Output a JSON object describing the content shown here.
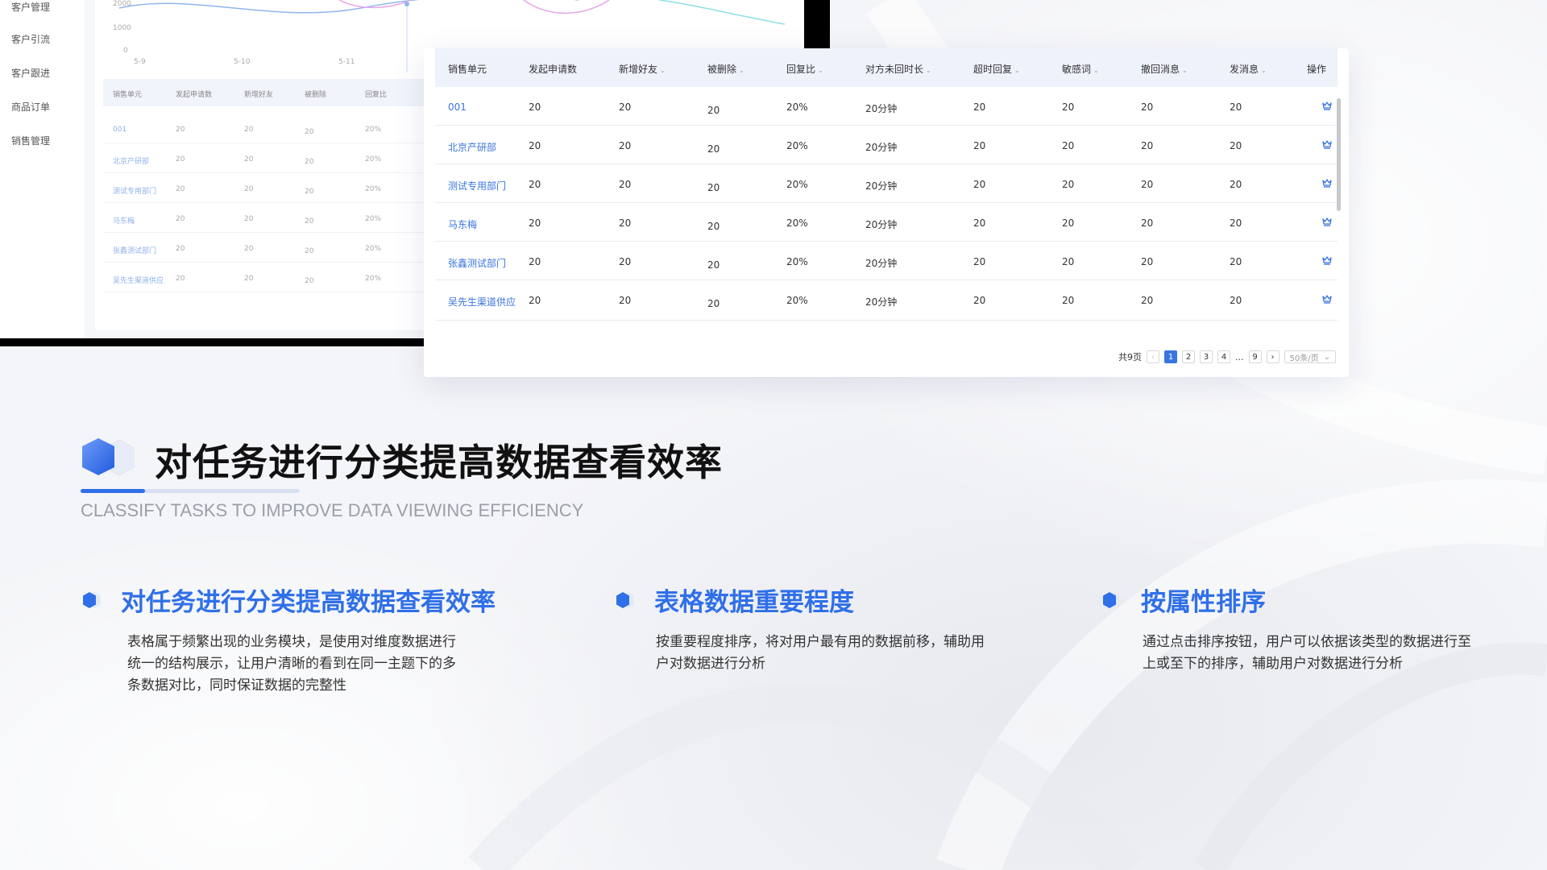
{
  "background_screen": {
    "sidebar": [
      "客户管理",
      "客户引流",
      "客户跟进",
      "商品订单",
      "销售管理"
    ],
    "chart_y_labels": [
      "2000",
      "1000",
      "0"
    ],
    "chart_x_labels": [
      "5-9",
      "5-10",
      "5-11"
    ],
    "headers": [
      "销售单元",
      "发起申请数",
      "新增好友",
      "被删除",
      "回复比"
    ],
    "rows": [
      [
        "001",
        "20",
        "20",
        "20",
        "20%"
      ],
      [
        "北京产研部",
        "20",
        "20",
        "20",
        "20%"
      ],
      [
        "测试专用部门",
        "20",
        "20",
        "20",
        "20%"
      ],
      [
        "马东梅",
        "20",
        "20",
        "20",
        "20%"
      ],
      [
        "张鑫测试部门",
        "20",
        "20",
        "20",
        "20%"
      ],
      [
        "吴先生渠道供应",
        "20",
        "20",
        "20",
        "20%"
      ]
    ]
  },
  "table": {
    "headers": [
      "销售单元",
      "发起申请数",
      "新增好友",
      "被删除",
      "回复比",
      "对方未回时长",
      "超时回复",
      "敏感词",
      "撤回消息",
      "发消息",
      "操作"
    ],
    "sortable": [
      false,
      false,
      true,
      true,
      true,
      true,
      true,
      true,
      true,
      true,
      false
    ],
    "rows": [
      [
        "001",
        "20",
        "20",
        "20",
        "20%",
        "20分钟",
        "20",
        "20",
        "20",
        "20"
      ],
      [
        "北京产研部",
        "20",
        "20",
        "20",
        "20%",
        "20分钟",
        "20",
        "20",
        "20",
        "20"
      ],
      [
        "测试专用部门",
        "20",
        "20",
        "20",
        "20%",
        "20分钟",
        "20",
        "20",
        "20",
        "20"
      ],
      [
        "马东梅",
        "20",
        "20",
        "20",
        "20%",
        "20分钟",
        "20",
        "20",
        "20",
        "20"
      ],
      [
        "张鑫测试部门",
        "20",
        "20",
        "20",
        "20%",
        "20分钟",
        "20",
        "20",
        "20",
        "20"
      ],
      [
        "吴先生渠道供应",
        "20",
        "20",
        "20",
        "20%",
        "20分钟",
        "20",
        "20",
        "20",
        "20"
      ]
    ],
    "row_action_icon": "crown-icon"
  },
  "pagination": {
    "total": "共9页",
    "prev": "‹",
    "pages": [
      "1",
      "2",
      "3",
      "4"
    ],
    "ellipsis": "...",
    "last": "9",
    "next": "›",
    "page_size": "50条/页",
    "active_page": "1"
  },
  "hero": {
    "title": "对任务进行分类提高数据查看效率",
    "subtitle": "CLASSIFY TASKS TO IMPROVE DATA VIEWING EFFICIENCY"
  },
  "features": [
    {
      "title": "对任务进行分类提高数据查看效率",
      "desc": "表格属于频繁出现的业务模块，是使用对维度数据进行统一的结构展示，让用户清晰的看到在同一主题下的多条数据对比，同时保证数据的完整性"
    },
    {
      "title": "表格数据重要程度",
      "desc": "按重要程度排序，将对用户最有用的数据前移，辅助用户对数据进行分析"
    },
    {
      "title": "按属性排序",
      "desc": "通过点击排序按钮，用户可以依据该类型的数据进行至上或至下的排序，辅助用户对数据进行分析"
    }
  ],
  "colors": {
    "accent": "#2f6fe8",
    "link": "#3a74e0",
    "header_bg": "#eef2fb"
  }
}
